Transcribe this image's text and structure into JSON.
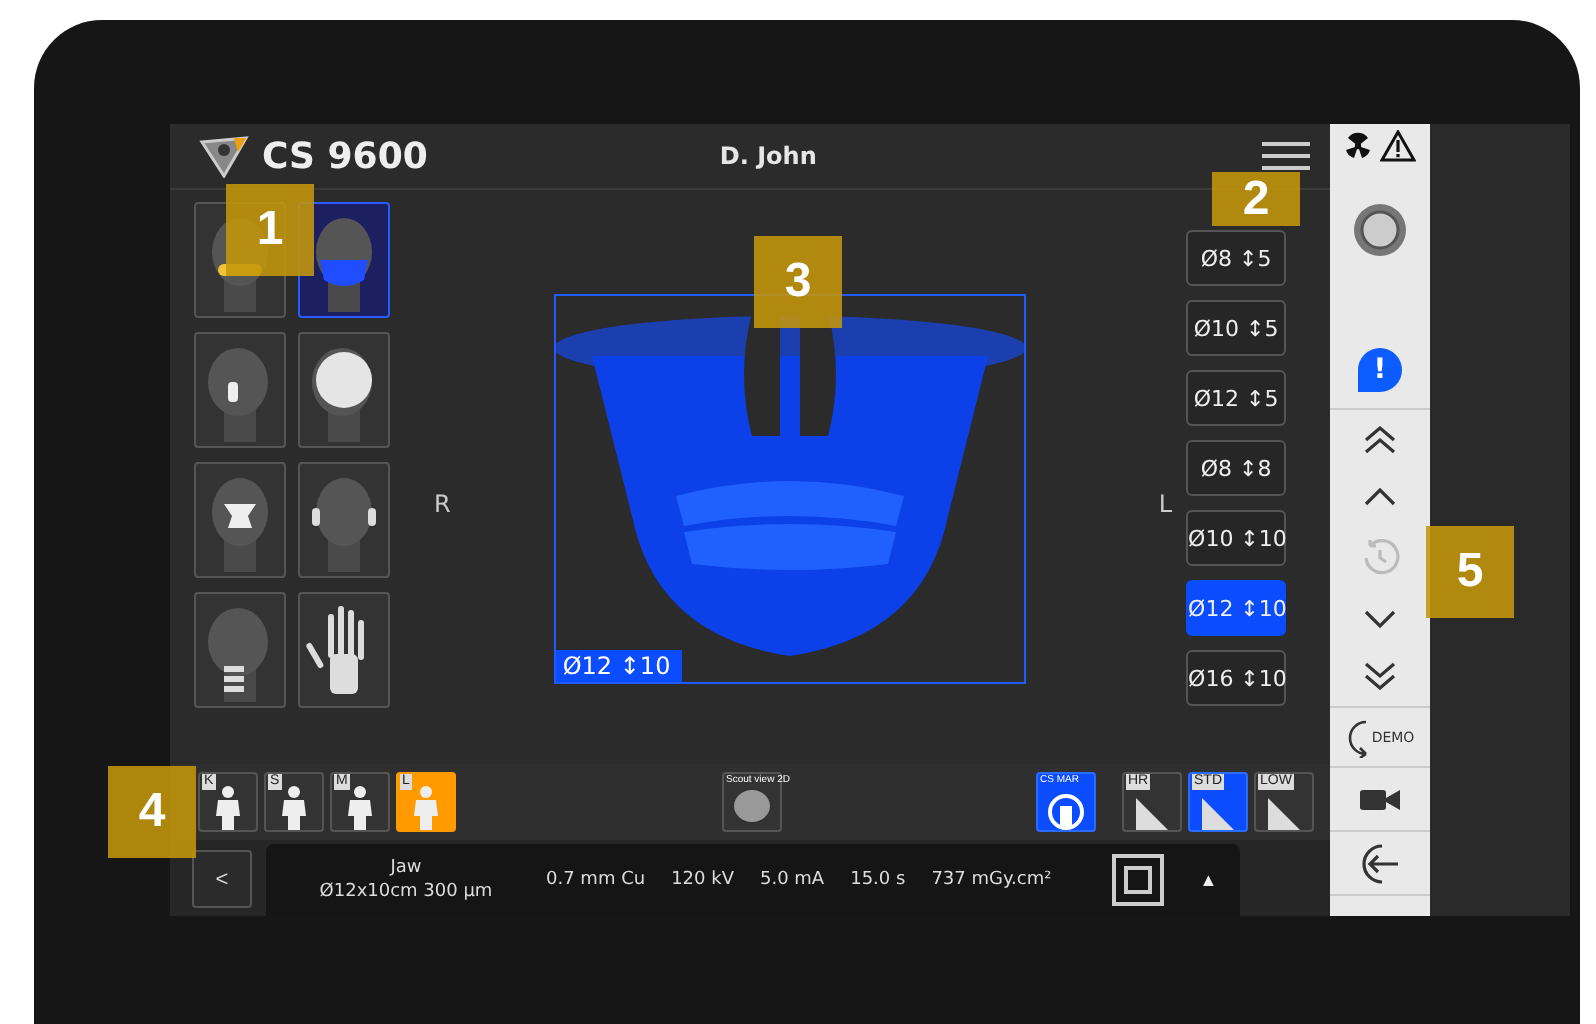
{
  "header": {
    "product": "CS 9600",
    "patient": "D. John"
  },
  "thumbnails": [
    {
      "kind": "dental-arch",
      "selected": false
    },
    {
      "kind": "jaw",
      "selected": true
    },
    {
      "kind": "tmj",
      "selected": false
    },
    {
      "kind": "skull-side",
      "selected": false
    },
    {
      "kind": "sinus",
      "selected": false
    },
    {
      "kind": "ears",
      "selected": false
    },
    {
      "kind": "spine",
      "selected": false
    },
    {
      "kind": "hand",
      "selected": false
    }
  ],
  "side_labels": {
    "left": "R",
    "right": "L"
  },
  "preview": {
    "label": "Ø12 ↕10"
  },
  "fov_options": [
    {
      "label": "Ø8 ↕5",
      "selected": false
    },
    {
      "label": "Ø10 ↕5",
      "selected": false
    },
    {
      "label": "Ø12 ↕5",
      "selected": false
    },
    {
      "label": "Ø8 ↕8",
      "selected": false
    },
    {
      "label": "Ø10 ↕10",
      "selected": false
    },
    {
      "label": "Ø12 ↕10",
      "selected": true
    },
    {
      "label": "Ø16 ↕10",
      "selected": false
    }
  ],
  "patient_sizes": [
    {
      "label": "K",
      "selected": false
    },
    {
      "label": "S",
      "selected": false
    },
    {
      "label": "M",
      "selected": false
    },
    {
      "label": "L",
      "selected": true
    }
  ],
  "scout_view": {
    "label": "Scout view 2D"
  },
  "mar": {
    "label": "CS MAR",
    "on": true
  },
  "resolutions": [
    {
      "label": "HR",
      "selected": false
    },
    {
      "label": "STD",
      "selected": true
    },
    {
      "label": "LOW",
      "selected": false
    }
  ],
  "summary": {
    "back": "<",
    "region": "Jaw",
    "fov": "Ø12x10cm 300 µm",
    "filter": "0.7 mm Cu",
    "voltage": "120 kV",
    "current": "5.0 mA",
    "time": "15.0 s",
    "dose": "737 mGy.cm²",
    "expand": "▲"
  },
  "side_panel": {
    "alert": "!",
    "history": {
      "disabled": true
    },
    "demo": "DEMO"
  },
  "callouts": [
    "1",
    "2",
    "3",
    "4",
    "5"
  ]
}
